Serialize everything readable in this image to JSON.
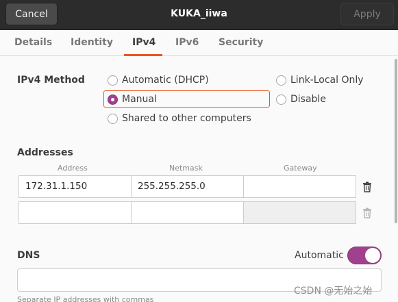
{
  "header": {
    "cancel_label": "Cancel",
    "title": "KUKA_iiwa",
    "apply_label": "Apply"
  },
  "tabs": [
    {
      "label": "Details"
    },
    {
      "label": "Identity"
    },
    {
      "label": "IPv4"
    },
    {
      "label": "IPv6"
    },
    {
      "label": "Security"
    }
  ],
  "active_tab": "IPv4",
  "ipv4_method": {
    "label": "IPv4 Method",
    "options": [
      {
        "label": "Automatic (DHCP)",
        "checked": false
      },
      {
        "label": "Manual",
        "checked": true
      },
      {
        "label": "Shared to other computers",
        "checked": false
      },
      {
        "label": "Link-Local Only",
        "checked": false
      },
      {
        "label": "Disable",
        "checked": false
      }
    ]
  },
  "addresses": {
    "label": "Addresses",
    "columns": [
      "Address",
      "Netmask",
      "Gateway"
    ],
    "rows": [
      {
        "address": "172.31.1.150",
        "netmask": "255.255.255.0",
        "gateway": ""
      },
      {
        "address": "",
        "netmask": "",
        "gateway": ""
      }
    ]
  },
  "dns": {
    "label": "DNS",
    "automatic_label": "Automatic",
    "automatic_on": true,
    "value": "",
    "hint": "Separate IP addresses with commas"
  },
  "watermark": "CSDN @无始之始",
  "colors": {
    "accent_purple": "#a0418f",
    "focus_orange": "#e95420",
    "header_bg": "#2c2c2c"
  }
}
